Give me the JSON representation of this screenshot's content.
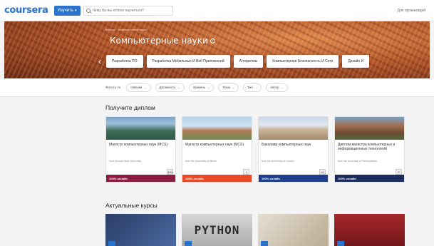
{
  "header": {
    "logo": "coursera",
    "explore_label": "Изучить",
    "search_placeholder": "Чему бы вы хотели научиться?",
    "business_link": "Для организаций"
  },
  "hero": {
    "breadcrumb": "Каталог › Компьютерные науки",
    "title": "Компьютерные науки",
    "chips": [
      "Разработка ПО",
      "Разработка Мобильных И Веб Приложений",
      "Алгоритмы",
      "Компьютерная Безопасность И Сети",
      "Дизайн И"
    ]
  },
  "filters": {
    "label": "Фильтр по",
    "items": [
      "Навыки",
      "Должность",
      "Уровень",
      "Язык",
      "Тип",
      "Автор"
    ]
  },
  "degrees": {
    "title": "Получите диплом",
    "cards": [
      {
        "title": "Магистр компьютерных наук (MCS)",
        "university": "from Arizona State University",
        "logo": "ASU",
        "foot": "100% онлайн",
        "foot_color": "#8c1d40"
      },
      {
        "title": "Магистр компьютерных наук (MCS)",
        "university": "from the University of Illinois",
        "logo": "I",
        "foot": "100% онлайн",
        "foot_color": "#e84a27"
      },
      {
        "title": "Бакалавр компьютерных наук",
        "university": "from the University of London",
        "logo": "UL",
        "foot": "100% онлайн",
        "foot_color": "#1d3f8c"
      },
      {
        "title": "Диплом магистра компьютерных и информационных технологий",
        "university": "from the University of Pennsylvania",
        "logo": "P",
        "foot": "100% онлайн",
        "foot_color": "#1a2d5c"
      }
    ]
  },
  "courses": {
    "title": "Актуальные курсы",
    "items": [
      {
        "caption": ""
      },
      {
        "caption": "PYTHON"
      },
      {
        "caption": ""
      },
      {
        "caption": ""
      }
    ]
  }
}
